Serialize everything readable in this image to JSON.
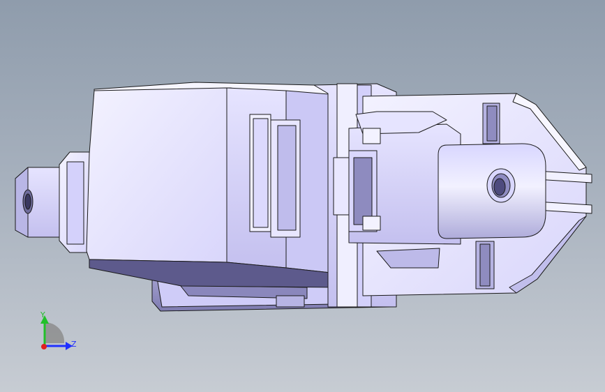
{
  "viewport": {
    "background_top": "#8f9cac",
    "background_bottom": "#c7ccd3",
    "model_face_color": "#eceaff",
    "model_shade_color": "#c9c6f0",
    "model_edge_color": "#1a1a1a"
  },
  "triad": {
    "y_label": "Y",
    "z_label": "Z",
    "y_color": "#22c02a",
    "z_color": "#2030ff",
    "x_color": "#e02020"
  }
}
